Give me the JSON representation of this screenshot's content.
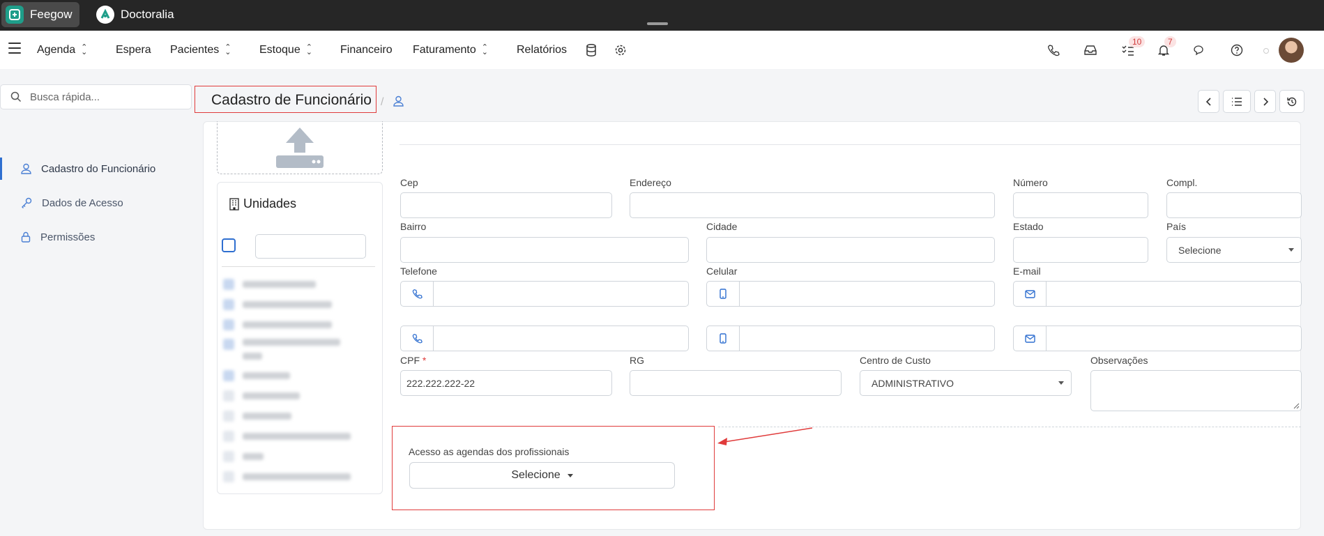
{
  "apps": [
    {
      "name": "Feegow"
    },
    {
      "name": "Doctoralia"
    }
  ],
  "nav": {
    "items": [
      "Agenda",
      "Espera",
      "Pacientes",
      "Estoque",
      "Financeiro",
      "Faturamento",
      "Relatórios"
    ],
    "tasks_badge": "10",
    "notifications_badge": "7"
  },
  "search": {
    "placeholder": "Busca rápida..."
  },
  "sidebar": {
    "items": [
      {
        "label": "Cadastro do Funcionário",
        "icon": "user-icon",
        "active": true
      },
      {
        "label": "Dados de Acesso",
        "icon": "key-icon",
        "active": false
      },
      {
        "label": "Permissões",
        "icon": "lock-icon",
        "active": false
      }
    ]
  },
  "header": {
    "title": "Cadastro de Funcionário",
    "breadcrumb_sep": "/"
  },
  "units": {
    "title": "Unidades"
  },
  "form": {
    "cep": {
      "label": "Cep",
      "value": ""
    },
    "endereco": {
      "label": "Endereço",
      "value": ""
    },
    "numero": {
      "label": "Número",
      "value": ""
    },
    "compl": {
      "label": "Compl.",
      "value": ""
    },
    "bairro": {
      "label": "Bairro",
      "value": ""
    },
    "cidade": {
      "label": "Cidade",
      "value": ""
    },
    "estado": {
      "label": "Estado",
      "value": ""
    },
    "pais": {
      "label": "País",
      "value": "Selecione"
    },
    "telefone": {
      "label": "Telefone"
    },
    "celular": {
      "label": "Celular"
    },
    "email": {
      "label": "E-mail"
    },
    "cpf": {
      "label": "CPF",
      "required_mark": "*",
      "value": "222.222.222-22"
    },
    "rg": {
      "label": "RG",
      "value": ""
    },
    "centro_custo": {
      "label": "Centro de Custo",
      "value": "ADMINISTRATIVO"
    },
    "observacoes": {
      "label": "Observações",
      "value": ""
    },
    "agendas": {
      "label": "Acesso as agendas dos profissionais",
      "value": "Selecione"
    }
  },
  "colors": {
    "accent": "#2f6fd0",
    "annotation": "#e03b3b",
    "topbar": "#262626"
  }
}
